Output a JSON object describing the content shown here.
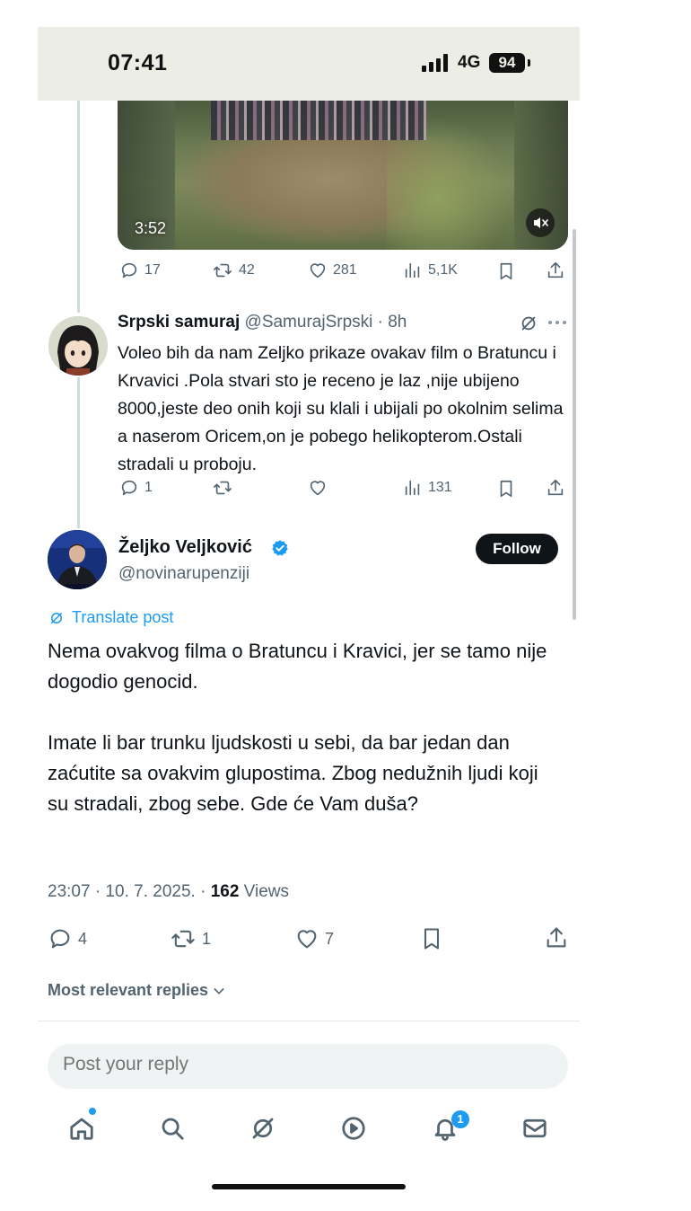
{
  "status_bar": {
    "time": "07:41",
    "network": "4G",
    "battery": "94"
  },
  "video": {
    "duration": "3:52"
  },
  "top_actions": {
    "replies": "17",
    "reposts": "42",
    "likes": "281",
    "views": "5,1K"
  },
  "reply": {
    "name": "Srpski samuraj",
    "handle": "@SamurajSrpski · 8h",
    "text": "Voleo bih da nam Zeljko prikaze ovakav film o Bratuncu  i Krvavici .Pola stvari sto je receno je laz ,nije ubijeno 8000,jeste deo onih koji su klali i ubijali po okolnim selima a naserom Oricem,on je pobego helikopterom.Ostali stradali u proboju.",
    "actions": {
      "replies": "1",
      "reposts": "",
      "likes": "",
      "views": "131"
    }
  },
  "main": {
    "name": "Željko Veljković",
    "handle": "@novinarupenziji",
    "follow_label": "Follow",
    "translate_label": "Translate post",
    "paragraph_1": "Nema ovakvog filma o Bratuncu i Kravici, jer se tamo nije dogodio genocid.",
    "paragraph_2": "Imate li bar trunku ljudskosti u sebi, da bar jedan dan zaćutite sa ovakvim glupostima. Zbog nedužnih ljudi koji su stradali, zbog sebe. Gde će Vam duša?",
    "timestamp": "23:07 · 10. 7. 2025. · ",
    "views_count": "162",
    "views_label": " Views",
    "actions": {
      "replies": "4",
      "reposts": "1",
      "likes": "7"
    }
  },
  "replies_sort_label": "Most relevant replies",
  "reply_input": {
    "placeholder": "Post your reply"
  },
  "nav": {
    "notification_count": "1"
  },
  "colors": {
    "accent": "#1d9bf0",
    "text": "#0f1419",
    "muted": "#536471"
  }
}
